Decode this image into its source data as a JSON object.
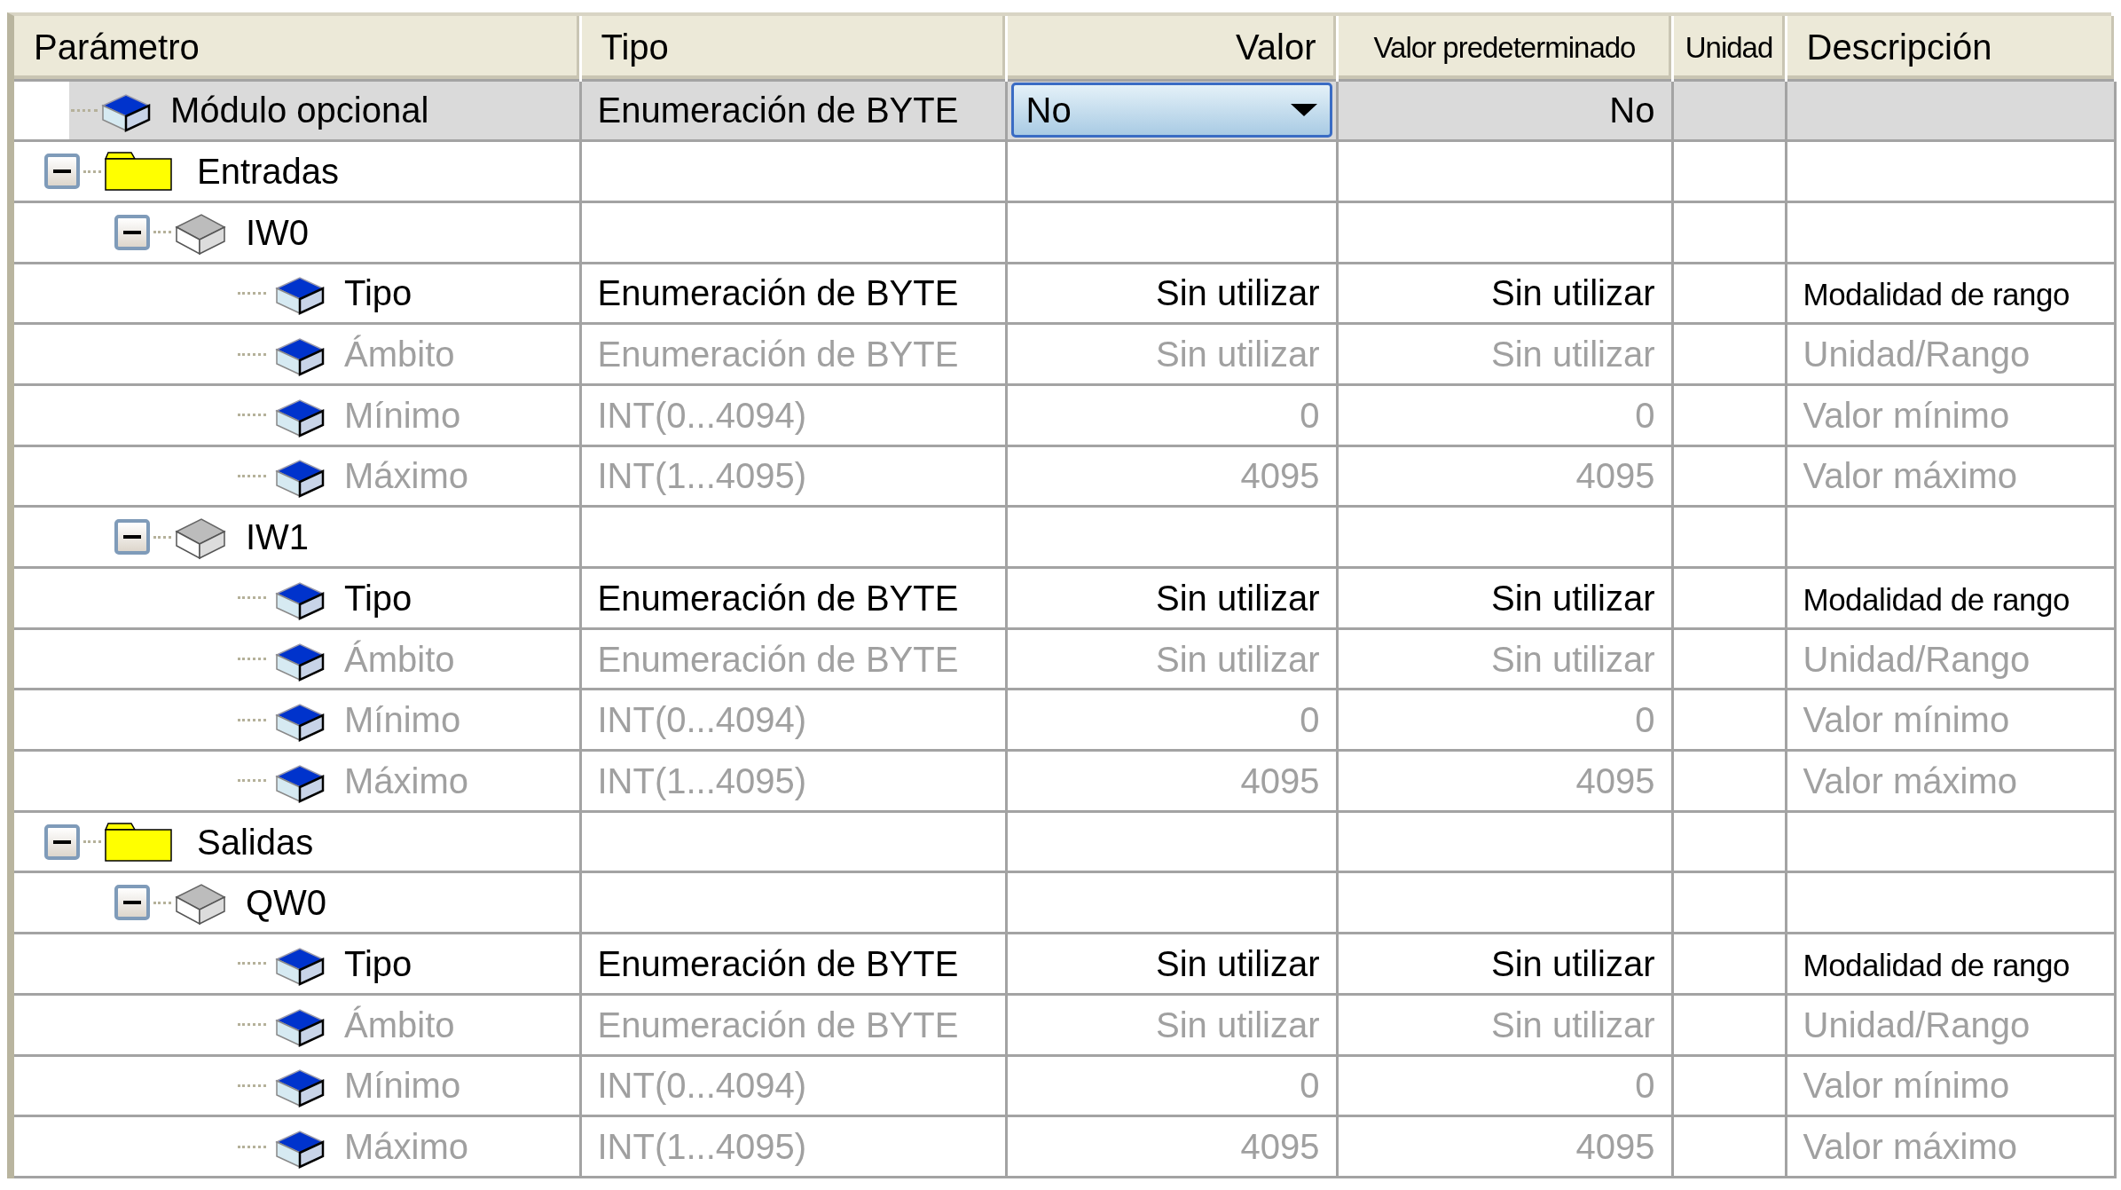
{
  "columns": [
    {
      "label": "Parámetro",
      "narrow": false
    },
    {
      "label": "Tipo",
      "narrow": false
    },
    {
      "label": "Valor",
      "narrow": false
    },
    {
      "label": "Valor predeterminado",
      "narrow": true
    },
    {
      "label": "Unidad",
      "narrow": true
    },
    {
      "label": "Descripción",
      "narrow": false
    }
  ],
  "rows": [
    {
      "kind": "module",
      "name": "Módulo opcional",
      "type": "Enumeración de BYTE",
      "value": "No",
      "default": "No",
      "selected": true,
      "disabled": false
    },
    {
      "kind": "folder",
      "name": "Entradas",
      "expanded": true,
      "selected": false,
      "children": [
        {
          "kind": "channel",
          "name": "IW0",
          "expanded": true,
          "selected": false,
          "children": [
            {
              "kind": "param",
              "name": "Tipo",
              "type": "Enumeración de BYTE",
              "value": "Sin utilizar",
              "default": "Sin utilizar",
              "description": "Modalidad de rango",
              "selected": false,
              "disabled": false
            },
            {
              "kind": "param",
              "name": "Ámbito",
              "type": "Enumeración de BYTE",
              "value": "Sin utilizar",
              "default": "Sin utilizar",
              "description": "Unidad/Rango",
              "selected": false,
              "disabled": true
            },
            {
              "kind": "param",
              "name": "Mínimo",
              "type": "INT(0...4094)",
              "value": "0",
              "default": "0",
              "description": "Valor mínimo",
              "selected": false,
              "disabled": true
            },
            {
              "kind": "param",
              "name": "Máximo",
              "type": "INT(1...4095)",
              "value": "4095",
              "default": "4095",
              "description": "Valor máximo",
              "selected": false,
              "disabled": true
            }
          ]
        },
        {
          "kind": "channel",
          "name": "IW1",
          "expanded": true,
          "selected": false,
          "children": [
            {
              "kind": "param",
              "name": "Tipo",
              "type": "Enumeración de BYTE",
              "value": "Sin utilizar",
              "default": "Sin utilizar",
              "description": "Modalidad de rango",
              "selected": false,
              "disabled": false
            },
            {
              "kind": "param",
              "name": "Ámbito",
              "type": "Enumeración de BYTE",
              "value": "Sin utilizar",
              "default": "Sin utilizar",
              "description": "Unidad/Rango",
              "selected": false,
              "disabled": true
            },
            {
              "kind": "param",
              "name": "Mínimo",
              "type": "INT(0...4094)",
              "value": "0",
              "default": "0",
              "description": "Valor mínimo",
              "selected": false,
              "disabled": true
            },
            {
              "kind": "param",
              "name": "Máximo",
              "type": "INT(1...4095)",
              "value": "4095",
              "default": "4095",
              "description": "Valor máximo",
              "selected": false,
              "disabled": true
            }
          ]
        }
      ]
    },
    {
      "kind": "folder",
      "name": "Salidas",
      "expanded": true,
      "selected": false,
      "children": [
        {
          "kind": "channel",
          "name": "QW0",
          "expanded": true,
          "selected": false,
          "children": [
            {
              "kind": "param",
              "name": "Tipo",
              "type": "Enumeración de BYTE",
              "value": "Sin utilizar",
              "default": "Sin utilizar",
              "description": "Modalidad de rango",
              "selected": false,
              "disabled": false
            },
            {
              "kind": "param",
              "name": "Ámbito",
              "type": "Enumeración de BYTE",
              "value": "Sin utilizar",
              "default": "Sin utilizar",
              "description": "Unidad/Rango",
              "selected": false,
              "disabled": true
            },
            {
              "kind": "param",
              "name": "Mínimo",
              "type": "INT(0...4094)",
              "value": "0",
              "default": "0",
              "description": "Valor mínimo",
              "selected": false,
              "disabled": true
            },
            {
              "kind": "param",
              "name": "Máximo",
              "type": "INT(1...4095)",
              "value": "4095",
              "default": "4095",
              "description": "Valor máximo",
              "selected": false,
              "disabled": true
            }
          ]
        }
      ]
    }
  ]
}
